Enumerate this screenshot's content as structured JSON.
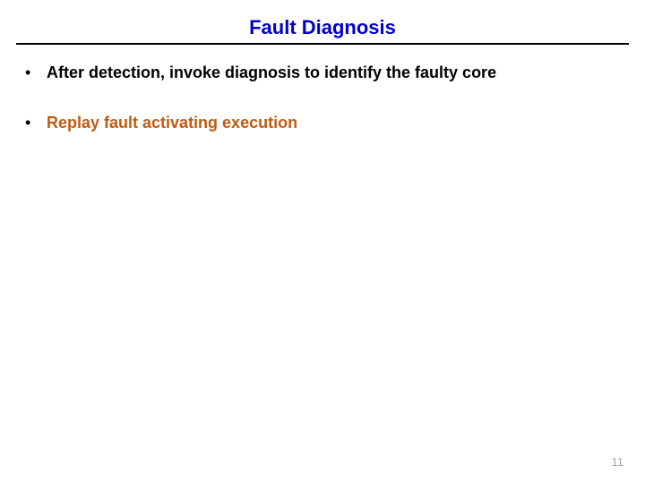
{
  "title": "Fault Diagnosis",
  "bullets": [
    {
      "text": "After detection, invoke diagnosis to identify the faulty core",
      "colorClass": "c-black"
    },
    {
      "text": "Replay fault activating execution",
      "colorClass": "c-orange"
    }
  ],
  "pageNumber": "11"
}
